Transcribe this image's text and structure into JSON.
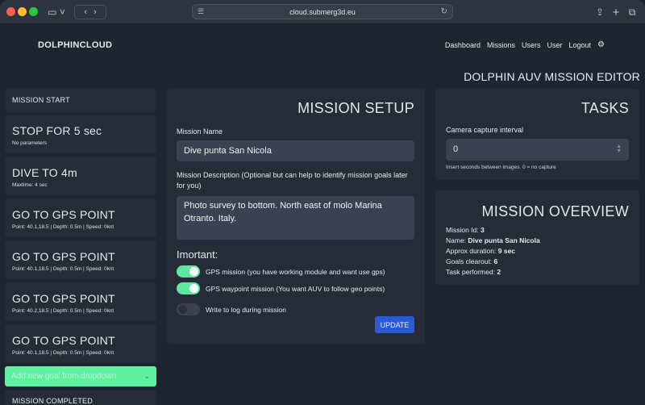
{
  "browser": {
    "url": "cloud.submerg3d.eu"
  },
  "nav": {
    "brand": "DOLPHINCLOUD",
    "links": [
      "Dashboard",
      "Missions",
      "Users",
      "User",
      "Logout"
    ],
    "settings_icon": "gear-icon"
  },
  "page": {
    "title": "DOLPHIN AUV MISSION EDITOR"
  },
  "goals": {
    "start": "MISSION START",
    "items": [
      {
        "title": "STOP FOR 5 sec",
        "sub": "No parameters"
      },
      {
        "title": "DIVE TO 4m",
        "sub": "Maxtime: 4 sec"
      },
      {
        "title": "GO TO GPS POINT",
        "sub": "Point: 40.1,18.5 | Depth: 0.5m | Speed: 0knt"
      },
      {
        "title": "GO TO GPS POINT",
        "sub": "Point: 40.1,18.5 | Depth: 0.5m | Speed: 0knt"
      },
      {
        "title": "GO TO GPS POINT",
        "sub": "Point: 40.2,18.5 | Depth: 0.5m | Speed: 0knt"
      },
      {
        "title": "GO TO GPS POINT",
        "sub": "Point: 40.1,18.5 | Depth: 0.5m | Speed: 0knt"
      }
    ],
    "add_placeholder": "Add new goal from dropdown",
    "completed": "MISSION COMPLETED"
  },
  "setup": {
    "title": "MISSION SETUP",
    "name_label": "Mission Name",
    "name_value": "Dive punta San Nicola",
    "desc_label": "Mission Description (Optional but can help to identify mission goals later for you)",
    "desc_value": "Photo survey to bottom. North east of molo Marina Otranto. Italy.",
    "important_label": "Imortant:",
    "toggles": [
      {
        "label": "GPS mission (you have working module and want use gps)",
        "on": true
      },
      {
        "label": "GPS waypoint mission (You want AUV to follow geo points)",
        "on": true
      },
      {
        "label": "Write to log during mission",
        "on": false
      }
    ],
    "update_label": "UPDATE"
  },
  "tasks": {
    "title": "TASKS",
    "interval_label": "Camera capture interval",
    "interval_value": "0",
    "hint": "Insert seconds between images. 0 = no capture"
  },
  "overview": {
    "title": "MISSION OVERVIEW",
    "rows": [
      {
        "label": "Mission Id:",
        "value": "3"
      },
      {
        "label": "Name:",
        "value": "Dive punta San Nicola"
      },
      {
        "label": "Approx duration:",
        "value": "9 sec"
      },
      {
        "label": "Goals clearout:",
        "value": "6"
      },
      {
        "label": "Task performed:",
        "value": "2"
      }
    ]
  },
  "colors": {
    "accent_green": "#5ee89d",
    "update_blue": "#2a5bd7",
    "background": "#1e2530",
    "panel": "#252c37"
  }
}
